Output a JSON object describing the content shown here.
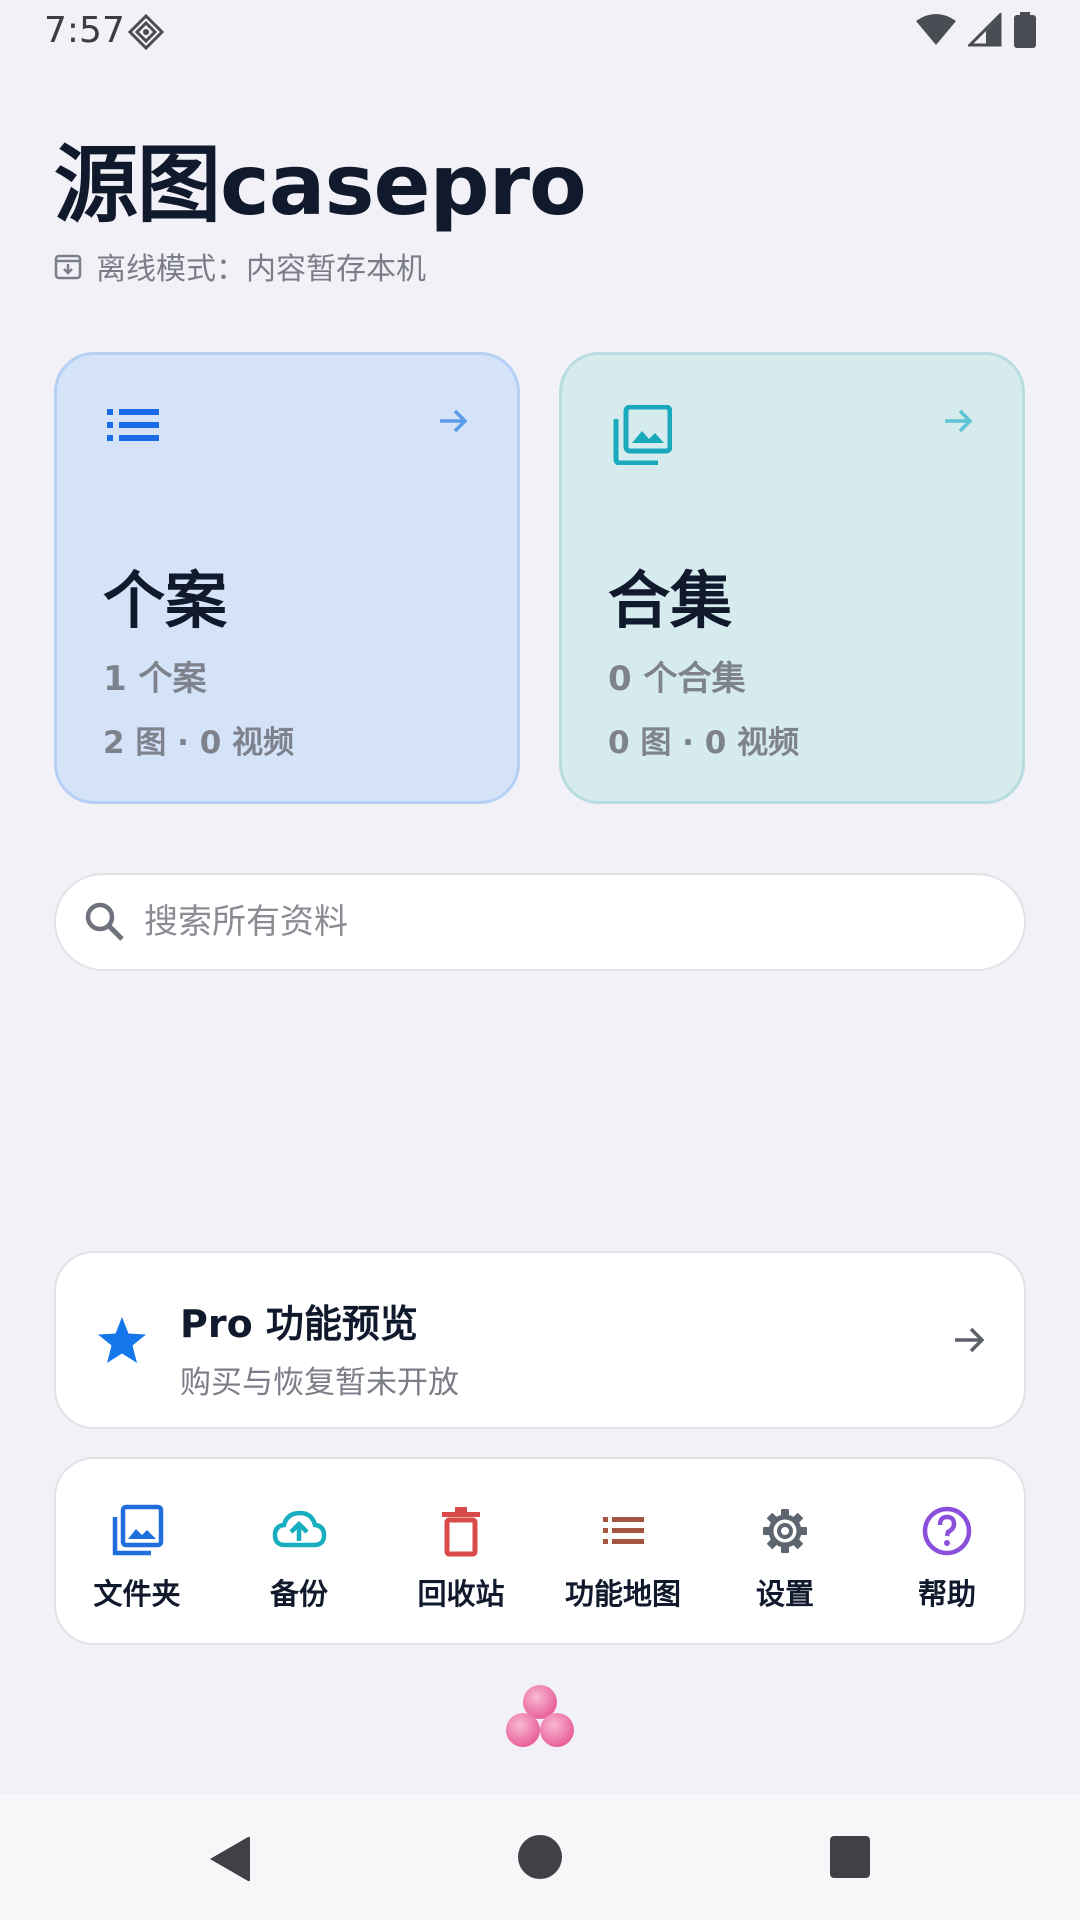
{
  "status_bar": {
    "time": "7:57"
  },
  "header": {
    "title": "源图casepro",
    "offline_text": "离线模式：内容暂存本机"
  },
  "cards": [
    {
      "title": "个案",
      "count": "1 个案",
      "media": "2 图 · 0 视频",
      "accent": "#1a6be8"
    },
    {
      "title": "合集",
      "count": "0 个合集",
      "media": "0 图 · 0 视频",
      "accent": "#1aa8bd"
    }
  ],
  "search": {
    "placeholder": "搜索所有资料",
    "value": ""
  },
  "pro": {
    "title": "Pro 功能预览",
    "subtitle": "购买与恢复暂未开放",
    "star_color": "#1677ea"
  },
  "toolbar": {
    "items": [
      {
        "label": "文件夹",
        "icon": "photo-library-icon",
        "color": "#1e6fdd"
      },
      {
        "label": "备份",
        "icon": "cloud-upload-icon",
        "color": "#17aebf"
      },
      {
        "label": "回收站",
        "icon": "trash-icon",
        "color": "#d94a4a"
      },
      {
        "label": "功能地图",
        "icon": "list-icon",
        "color": "#a3563f"
      },
      {
        "label": "设置",
        "icon": "gear-icon",
        "color": "#5d6570"
      },
      {
        "label": "帮助",
        "icon": "help-circle-icon",
        "color": "#8a4fdb"
      }
    ]
  },
  "nav": {
    "back": "back-icon",
    "home": "home-icon",
    "recents": "recents-icon"
  }
}
